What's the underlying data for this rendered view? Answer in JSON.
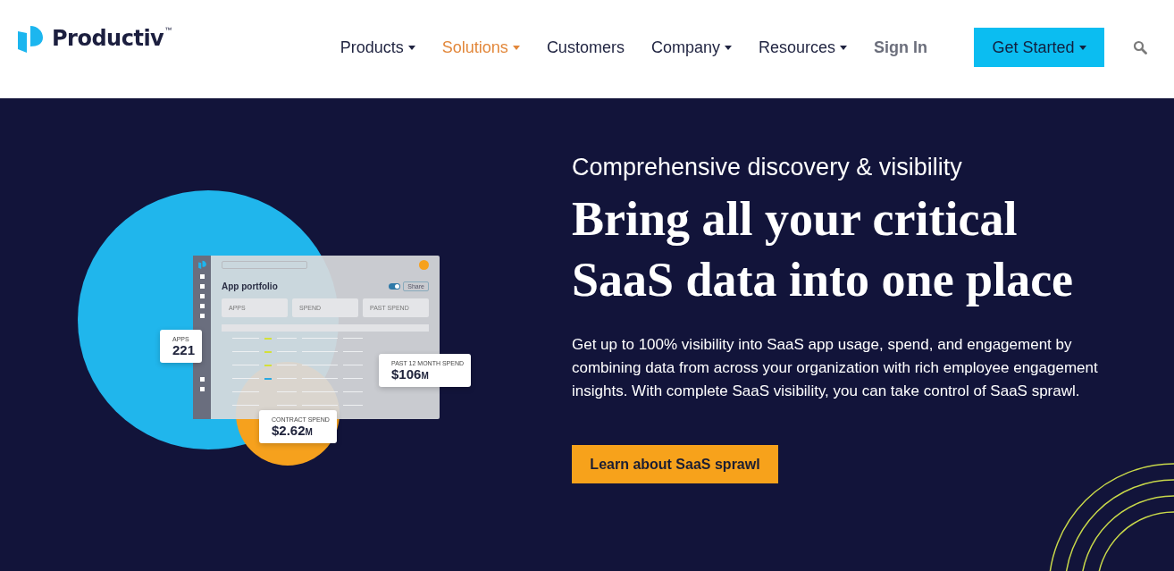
{
  "header": {
    "logo": {
      "name": "Productiv",
      "mark": "™"
    },
    "nav": [
      {
        "label": "Products",
        "has_menu": true,
        "selected": false
      },
      {
        "label": "Solutions",
        "has_menu": true,
        "selected": true
      },
      {
        "label": "Customers",
        "has_menu": false,
        "selected": false
      },
      {
        "label": "Company",
        "has_menu": true,
        "selected": false
      },
      {
        "label": "Resources",
        "has_menu": true,
        "selected": false
      }
    ],
    "sign_in": "Sign In",
    "cta": {
      "label": "Get Started",
      "has_menu": true
    }
  },
  "hero": {
    "illustration": {
      "title": "App portfolio",
      "toggle_on": true,
      "share": "Share",
      "stat_boxes": [
        "APPS",
        "SPEND",
        "PAST SPEND"
      ],
      "cards": [
        {
          "label": "APPS",
          "value": "221"
        },
        {
          "label": "PAST 12 MONTH SPEND",
          "value": "$106",
          "unit": "M"
        },
        {
          "label": "CONTRACT SPEND",
          "value": "$2.62",
          "unit": "M"
        }
      ]
    },
    "eyebrow": "Comprehensive discovery & visibility",
    "headline": "Bring all your critical SaaS data into one place",
    "body": "Get up to 100% visibility into SaaS app usage, spend, and engagement by combining data from across your organization with rich employee engagement insights. With complete SaaS visibility, you can take control of SaaS sprawl.",
    "button": "Learn about SaaS sprawl"
  }
}
